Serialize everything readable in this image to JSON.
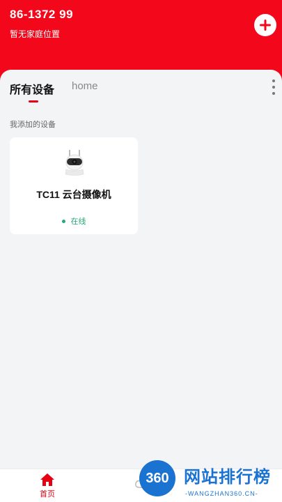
{
  "header": {
    "phone": "86-1372          99",
    "home_location": "暂无家庭位置",
    "add_icon": "plus-circle-icon"
  },
  "tabs": [
    {
      "label": "所有设备",
      "active": true
    },
    {
      "label": "home",
      "active": false
    }
  ],
  "more_icon": "vertical-dots-icon",
  "section": {
    "label": "我添加的设备"
  },
  "devices": [
    {
      "name": "TC11 云台摄像机",
      "status": "在线",
      "icon": "camera-icon"
    }
  ],
  "bottom_nav": {
    "home_label": "首页",
    "home_icon": "home-icon"
  },
  "watermark": {
    "badge": "360",
    "title": "网站排行榜",
    "subtitle": "-WANGZHAN360.CN-"
  },
  "colors": {
    "brand_red": "#f2071b",
    "online_green": "#2aa876",
    "watermark_blue": "#1a73d1"
  }
}
